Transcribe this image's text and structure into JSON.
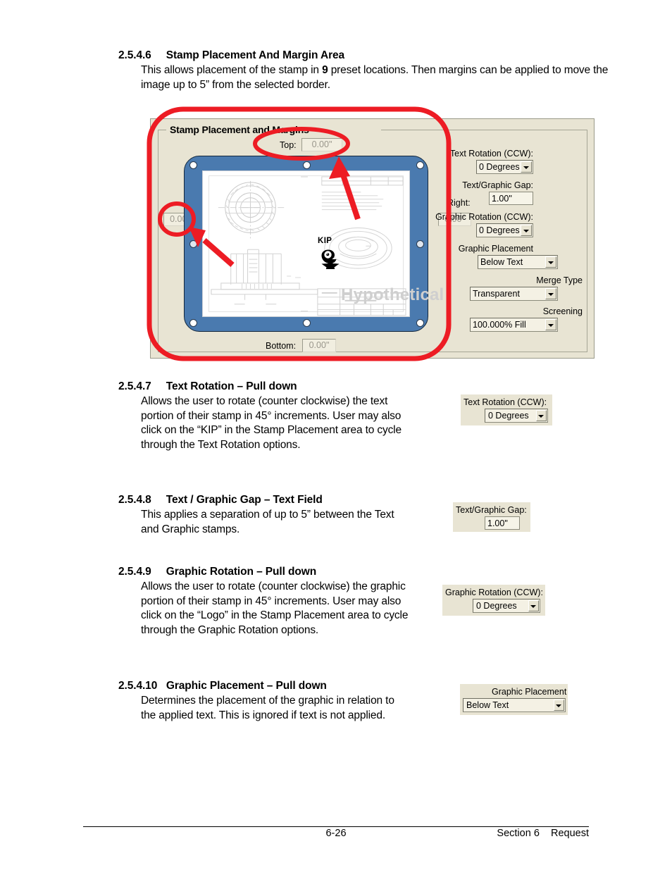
{
  "document": {
    "footer": {
      "page_number": "6-26",
      "right_text": "Section 6    Request"
    }
  },
  "sections": [
    {
      "number": "2.5.4.6",
      "title": "Stamp Placement And Margin Area",
      "body_pre": "This allows placement of the stamp in ",
      "body_bold": "9",
      "body_post": " preset locations.  Then margins can be applied to move the image up to 5” from the selected border."
    },
    {
      "number": "2.5.4.7",
      "title": "Text Rotation – Pull down",
      "body": "Allows the user to rotate (counter clockwise) the text portion of their stamp in 45° increments.  User may also click on the “KIP” in the Stamp Placement area to cycle through the Text Rotation options."
    },
    {
      "number": "2.5.4.8",
      "title": "Text / Graphic Gap – Text Field",
      "body": "This applies a separation of up to 5” between the Text and Graphic stamps."
    },
    {
      "number": "2.5.4.9",
      "title": "Graphic Rotation – Pull down",
      "body": "Allows the user to rotate (counter clockwise) the graphic portion of their stamp in 45° increments.  User may also click on the “Logo” in the Stamp Placement area to cycle through the Graphic Rotation options."
    },
    {
      "number": "2.5.4.10",
      "title": "Graphic Placement – Pull down",
      "body": "Determines the placement of the graphic in relation to the applied text. This is ignored if text is not applied."
    }
  ],
  "dialog": {
    "groupbox_title": "Stamp Placement and Margins",
    "margins": {
      "top_label": "Top:",
      "top_value": "0.00\"",
      "left_value": "0.00\"",
      "right_label": "Right:",
      "right_value": "0.00\"",
      "bottom_label": "Bottom:",
      "bottom_value": "0.00\""
    },
    "preview": {
      "stamp_text": "KIP",
      "watermark": "Hypothetical",
      "logo_icon": "kip-star-logo-icon"
    },
    "controls": [
      {
        "label": "Text Rotation (CCW):",
        "value": "0 Degrees",
        "type": "combo"
      },
      {
        "label": "Text/Graphic Gap:",
        "value": "1.00\"",
        "type": "text"
      },
      {
        "label": "Graphic Rotation (CCW):",
        "value": "0 Degrees",
        "type": "combo"
      },
      {
        "label": "Graphic Placement",
        "value": "Below Text",
        "type": "combo"
      },
      {
        "label": "Merge Type",
        "value": "Transparent",
        "type": "combo"
      },
      {
        "label": "Screening",
        "value": "100.000% Fill",
        "type": "combo"
      }
    ]
  },
  "annotation": {
    "color": "#ED1C24",
    "shapes": "rounded-rect-highlight, two-ellipse-highlights, two-arrows"
  },
  "mini_controls": [
    {
      "label": "Text Rotation (CCW):",
      "value": "0 Degrees",
      "type": "combo"
    },
    {
      "label": "Text/Graphic Gap:",
      "value": "1.00\"",
      "type": "text"
    },
    {
      "label": "Graphic Rotation (CCW):",
      "value": "0 Degrees",
      "type": "combo"
    },
    {
      "label": "Graphic Placement",
      "value": "Below Text",
      "type": "combo"
    }
  ]
}
